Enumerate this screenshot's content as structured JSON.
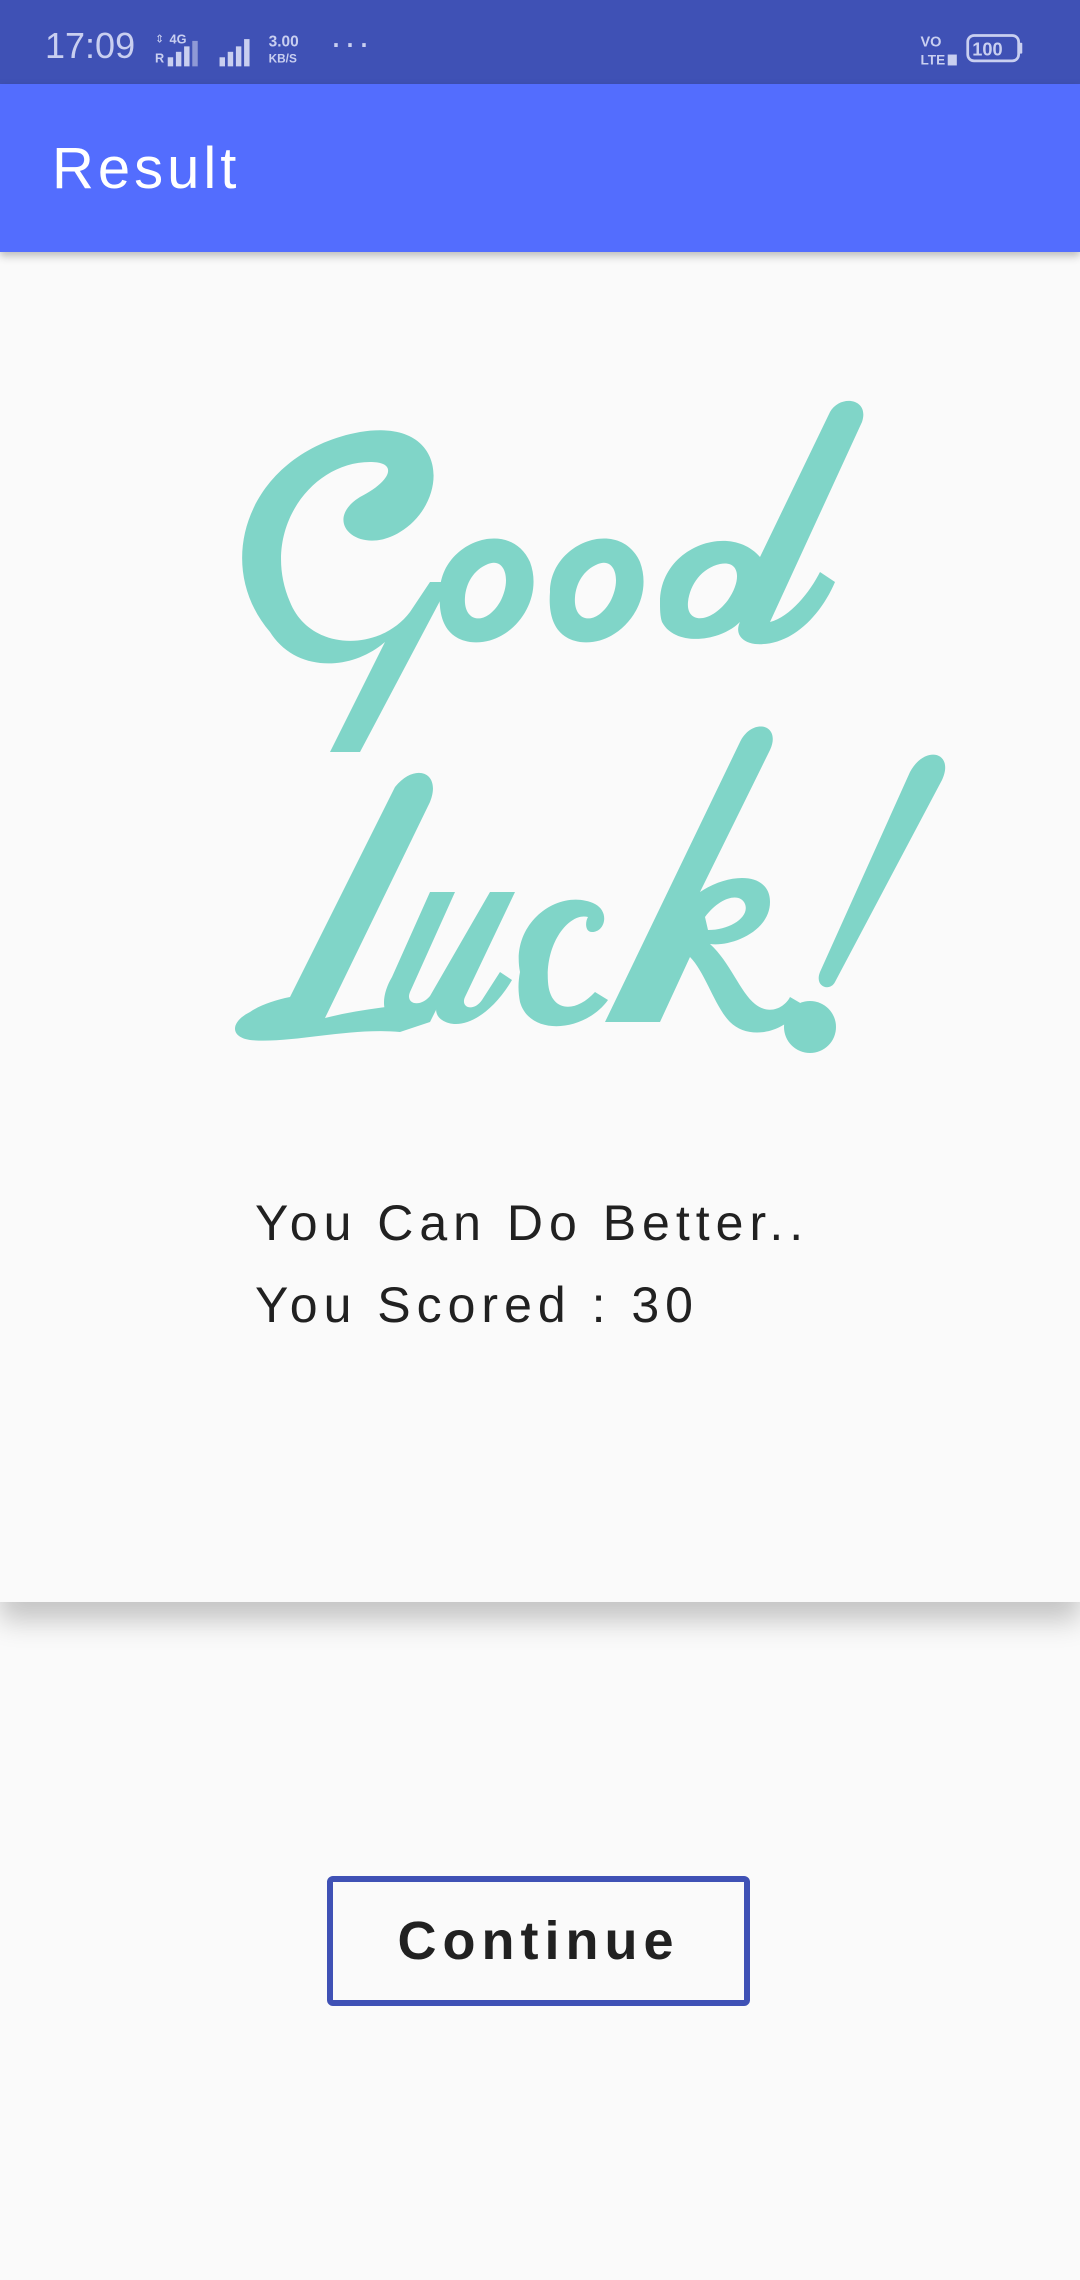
{
  "status_bar": {
    "time": "17:09",
    "network_label": "4G",
    "speed": "3.00",
    "speed_unit": "KB/S",
    "more": "···",
    "volte": "VO LTE",
    "battery": "100"
  },
  "app_bar": {
    "title": "Result"
  },
  "result": {
    "image_icon": "good-luck-script-image",
    "image_color": "#80d5c8",
    "message_line1": "You Can Do Better..",
    "message_line2_label": "You Scored : ",
    "score": "30"
  },
  "actions": {
    "continue_label": "Continue"
  },
  "colors": {
    "status_bar": "#3f51b5",
    "app_bar": "#536dfe",
    "button_border": "#3f51b5",
    "background": "#fafafa"
  }
}
